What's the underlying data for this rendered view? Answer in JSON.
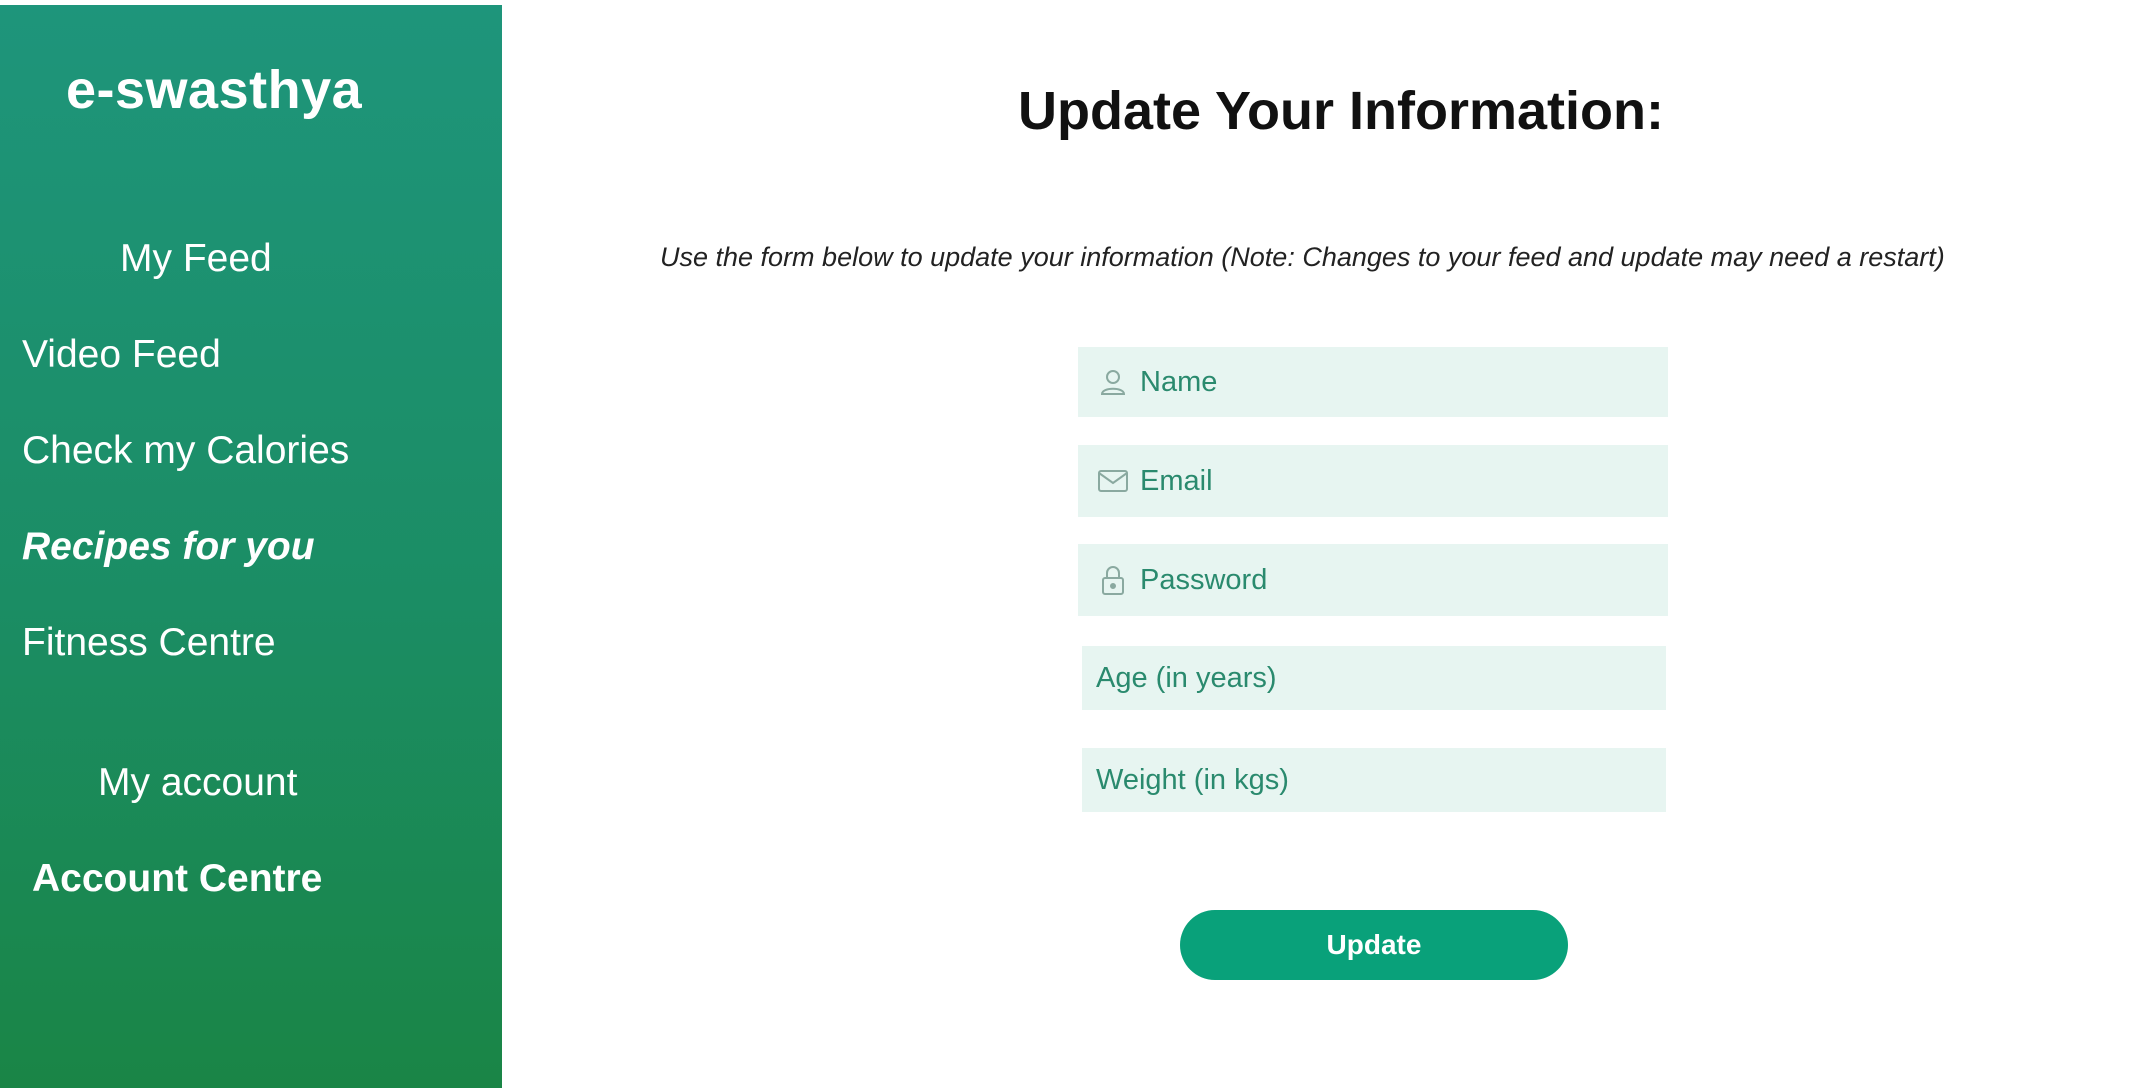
{
  "sidebar": {
    "brand": "e-swasthya",
    "items": [
      {
        "label": "My Feed"
      },
      {
        "label": "Video Feed"
      },
      {
        "label": "Check my Calories"
      },
      {
        "label": "Recipes for you"
      },
      {
        "label": "Fitness Centre"
      },
      {
        "label": "My account"
      },
      {
        "label": "Account Centre"
      }
    ]
  },
  "main": {
    "title": "Update Your Information:",
    "note": "Use the form below to update your information (Note: Changes to your feed and update may need a restart)",
    "form": {
      "name_placeholder": "Name",
      "email_placeholder": "Email",
      "password_placeholder": "Password",
      "age_placeholder": "Age (in years)",
      "weight_placeholder": "Weight (in kgs)",
      "submit_label": "Update"
    }
  },
  "colors": {
    "sidebar_top": "#1e957b",
    "sidebar_bottom": "#1a8546",
    "field_bg": "#e7f5f1",
    "field_text": "#2a8a6e",
    "button": "#09a17a"
  },
  "icons": {
    "name": "person-icon",
    "email": "envelope-icon",
    "password": "lock-icon"
  }
}
